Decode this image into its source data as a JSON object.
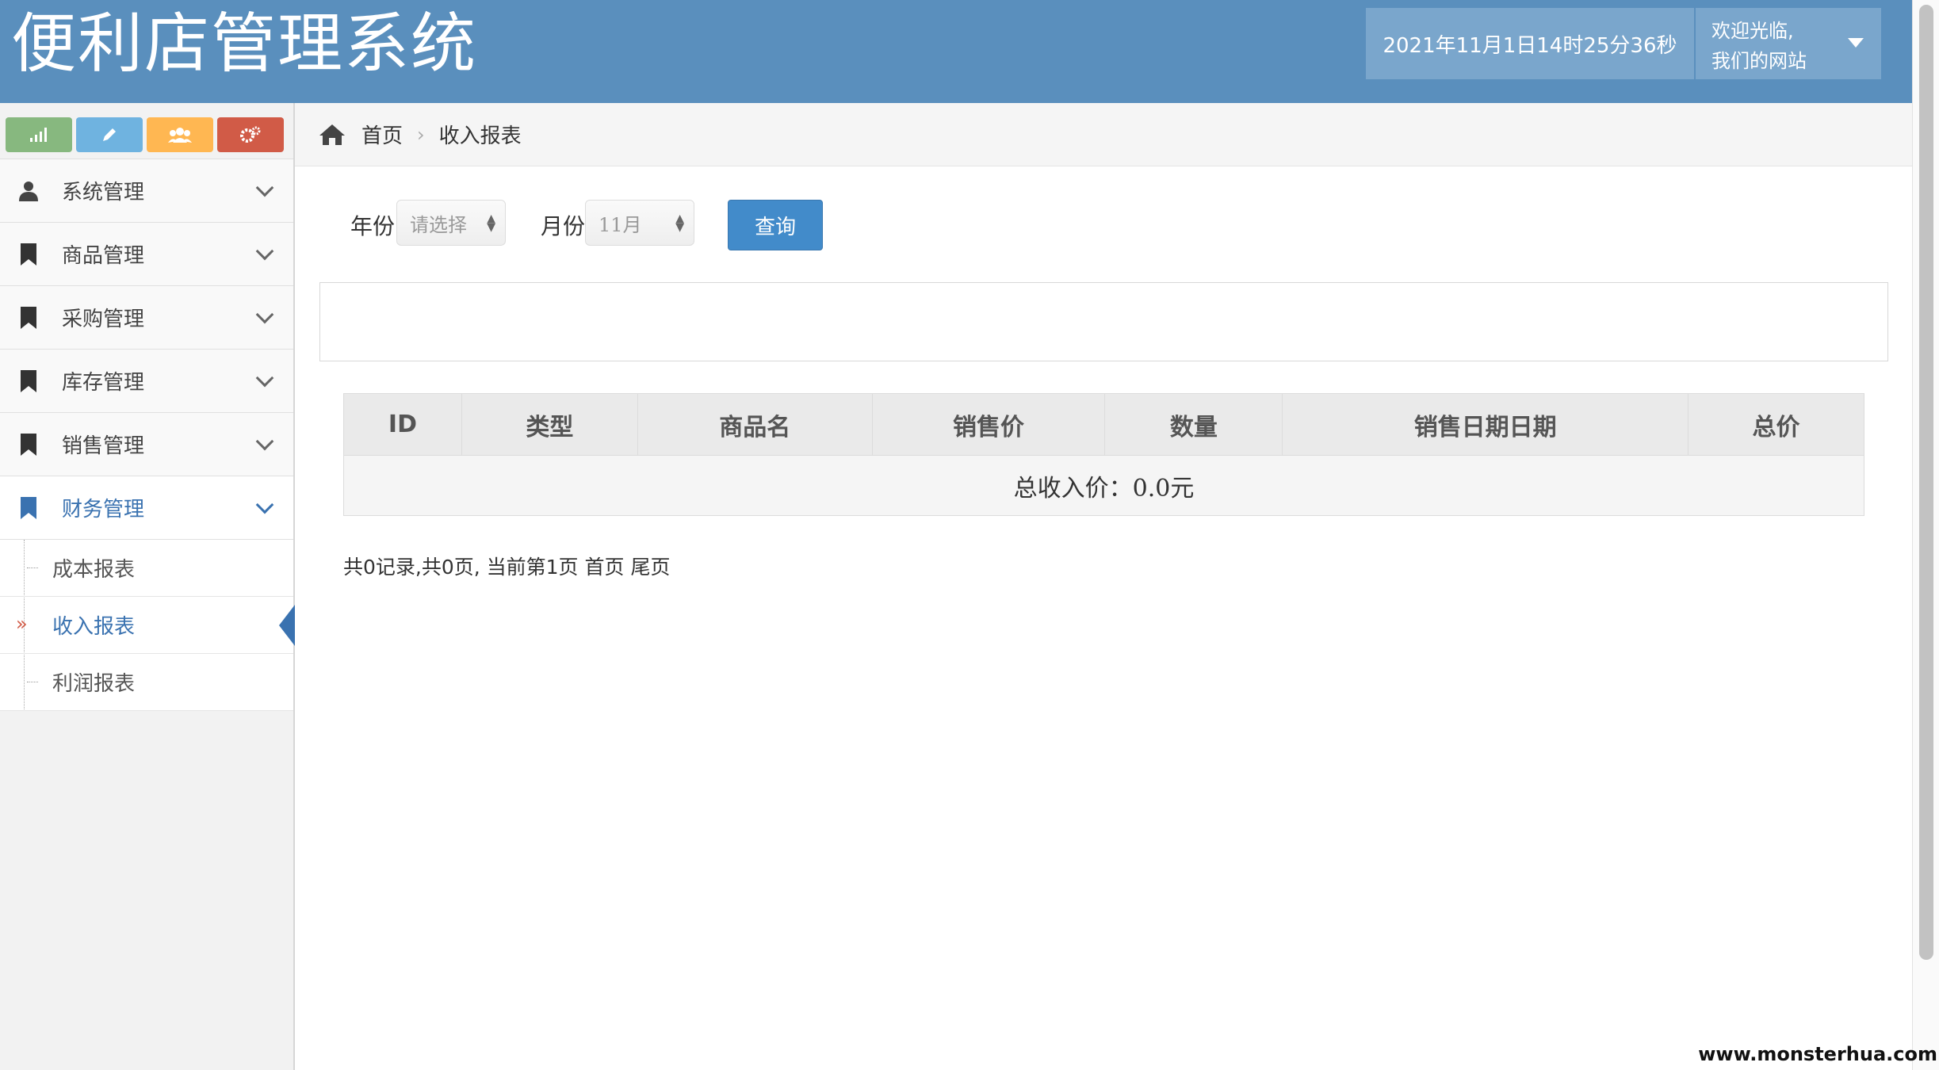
{
  "header": {
    "title": "便利店管理系统",
    "datetime": "2021年11月1日14时25分36秒",
    "welcome_line1": "欢迎光临,",
    "welcome_line2": "我们的网站"
  },
  "shortcuts": [
    {
      "icon": "signal-icon",
      "color": "#87b87f"
    },
    {
      "icon": "pencil-icon",
      "color": "#6fb3e0"
    },
    {
      "icon": "users-icon",
      "color": "#ffb752"
    },
    {
      "icon": "cogs-icon",
      "color": "#d15b47"
    }
  ],
  "sidebar": {
    "items": [
      {
        "label": "系统管理",
        "icon": "user-icon"
      },
      {
        "label": "商品管理",
        "icon": "bookmark-icon"
      },
      {
        "label": "采购管理",
        "icon": "bookmark-icon"
      },
      {
        "label": "库存管理",
        "icon": "bookmark-icon"
      },
      {
        "label": "销售管理",
        "icon": "bookmark-icon"
      },
      {
        "label": "财务管理",
        "icon": "bookmark-icon",
        "expanded": true
      }
    ],
    "sub_items": [
      {
        "label": "成本报表"
      },
      {
        "label": "收入报表",
        "current": true
      },
      {
        "label": "利润报表"
      }
    ]
  },
  "breadcrumb": {
    "home": "首页",
    "current": "收入报表"
  },
  "filter": {
    "year_label": "年份",
    "year_value": "请选择",
    "month_label": "月份",
    "month_value": "11月",
    "query_label": "查询"
  },
  "table": {
    "columns": [
      "ID",
      "类型",
      "商品名",
      "销售价",
      "数量",
      "销售日期日期",
      "总价"
    ],
    "total_row": "总收入价：0.0元"
  },
  "pagination": {
    "text": "共0记录,共0页, 当前第1页 首页 尾页"
  },
  "watermark": "www.monsterhua.com",
  "colors": {
    "header_bg": "#5a8fbd",
    "accent": "#3a72b0",
    "button": "#428bca"
  }
}
